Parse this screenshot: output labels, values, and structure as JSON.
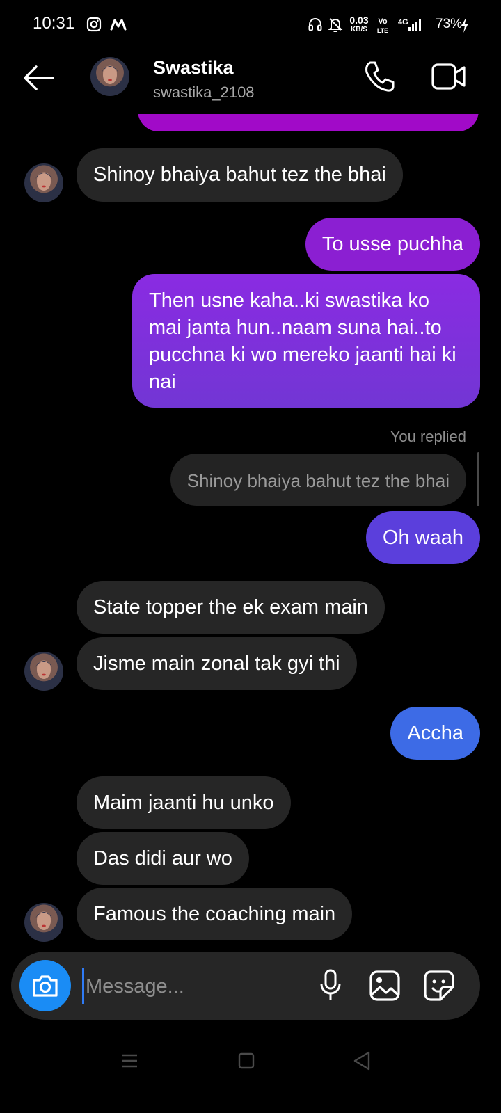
{
  "status_bar": {
    "time": "10:31",
    "net_speed_value": "0.03",
    "net_speed_unit": "KB/S",
    "volte_top": "Vo",
    "volte_bottom": "LTE",
    "network": "4G",
    "battery": "73%",
    "icons": [
      "instagram-icon",
      "m-logo-icon",
      "headphones-icon",
      "bell-muted-icon",
      "signal-icon",
      "charging-icon"
    ]
  },
  "header": {
    "name": "Swastika",
    "username": "swastika_2108",
    "icons": [
      "back-arrow-icon",
      "phone-icon",
      "video-call-icon"
    ]
  },
  "messages": {
    "m1": "Shinoy bhaiya bahut tez the bhai",
    "m2": "To usse puchha",
    "m3": "Then usne kaha..ki swastika ko mai janta hun..naam suna hai..to pucchna ki wo mereko jaanti hai ki nai",
    "reply_label": "You replied",
    "reply_quote": "Shinoy bhaiya bahut tez the bhai",
    "m4": "Oh waah",
    "m5": "State topper the ek exam main",
    "m6": "Jisme main zonal tak gyi thi",
    "m7": "Accha",
    "m8": "Maim jaanti hu unko",
    "m9": "Das didi aur wo",
    "m10": "Famous the coaching main"
  },
  "composer": {
    "placeholder": "Message...",
    "value": "",
    "icons": [
      "camera-icon",
      "microphone-icon",
      "gallery-icon",
      "sticker-icon"
    ]
  },
  "nav_bar": {
    "icons": [
      "menu-icon",
      "home-square-icon",
      "back-triangle-icon"
    ]
  },
  "colors": {
    "background": "#000000",
    "incoming_bubble": "#262626",
    "outgoing_purple": "#8b1fd2",
    "outgoing_indigo": "#5b3fdc",
    "outgoing_blue": "#3d6be6",
    "camera_button": "#1a8cf5"
  }
}
